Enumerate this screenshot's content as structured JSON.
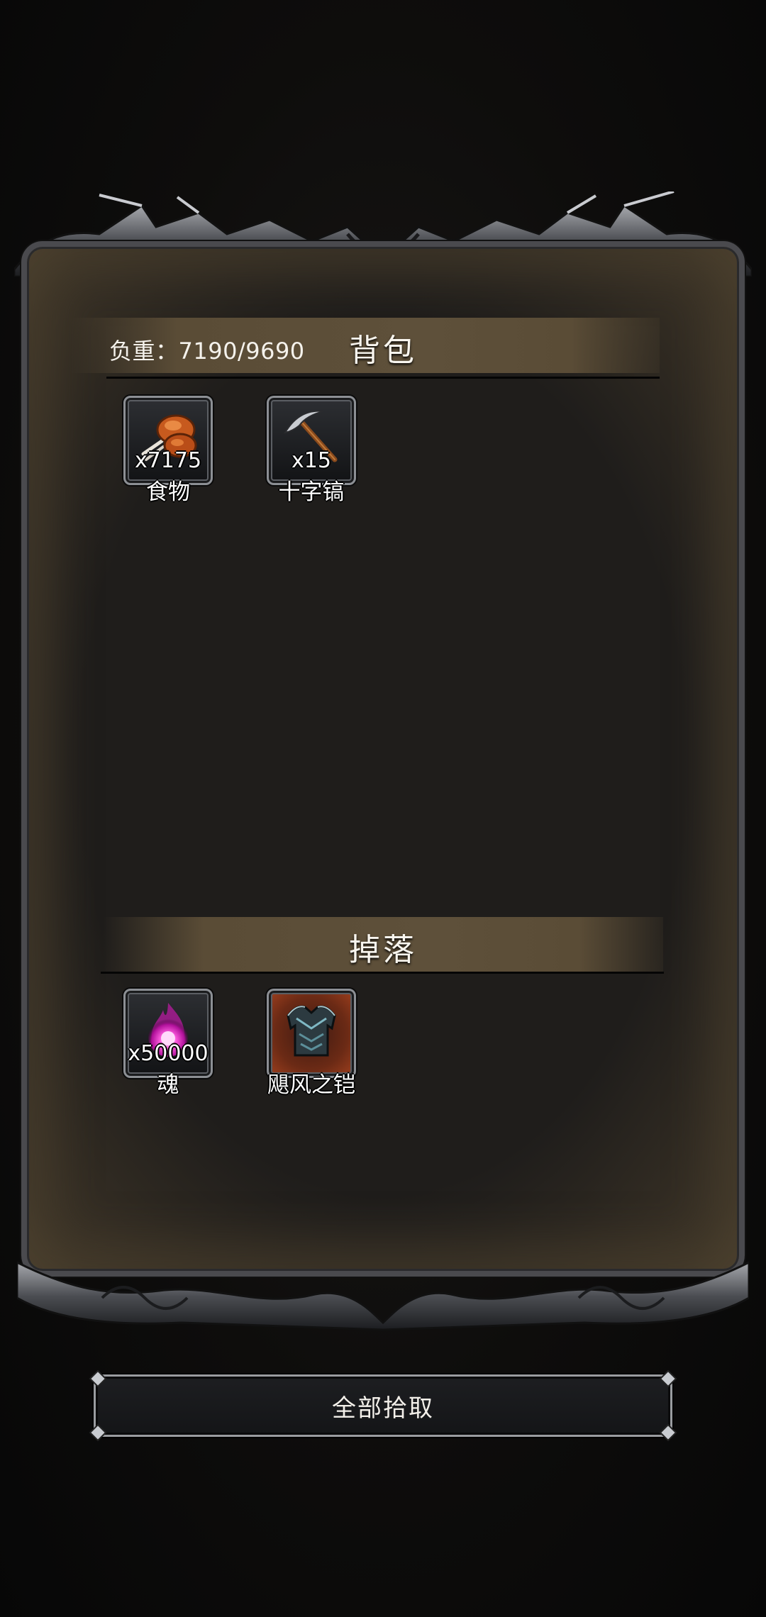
{
  "bag": {
    "weight_label": "负重：7190/9690",
    "title": "背包",
    "items": [
      {
        "name": "食物",
        "count": "x7175",
        "icon": "drumstick-icon"
      },
      {
        "name": "十字镐",
        "count": "x15",
        "icon": "pickaxe-icon"
      }
    ]
  },
  "drops": {
    "title": "掉落",
    "items": [
      {
        "name": "魂",
        "count": "x50000",
        "icon": "soul-orb-icon"
      },
      {
        "name": "飓风之铠",
        "count": "",
        "icon": "armor-icon"
      }
    ]
  },
  "actions": {
    "collect_all_label": "全部拾取"
  },
  "colors": {
    "background": "#0b0b0b",
    "panel_fill": "#1f1d1b",
    "header_bar": "#5e503a",
    "frame_metal": "#8c8f94",
    "soul_glow": "#ff3fd0",
    "rare_slot": "#a0401e"
  }
}
